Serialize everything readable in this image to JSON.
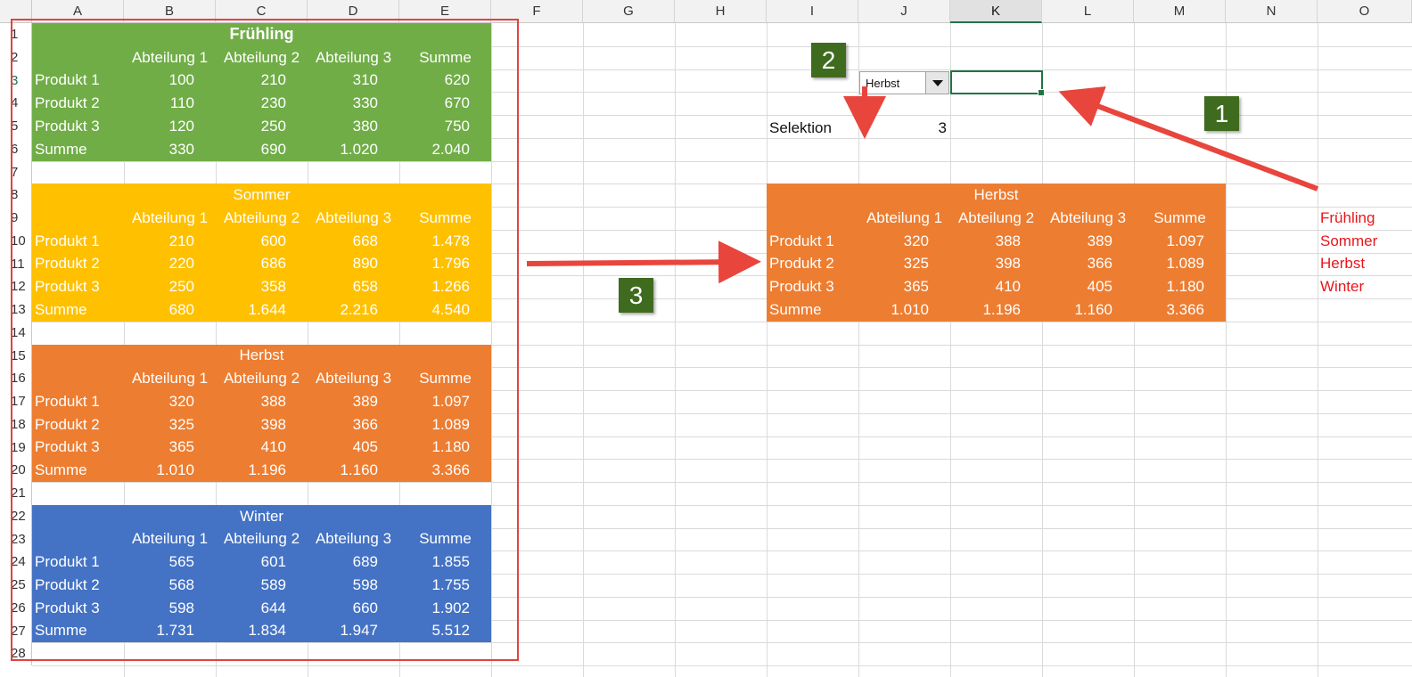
{
  "colors": {
    "spring": "#70ad47",
    "summer": "#ffc000",
    "autumn": "#ed7d31",
    "winter": "#4472c4",
    "arrow": "#e8453c",
    "badge": "#3f6b1f",
    "list_text": "#e8161b"
  },
  "columns": [
    "A",
    "B",
    "C",
    "D",
    "E",
    "F",
    "G",
    "H",
    "I",
    "J",
    "K",
    "L",
    "M",
    "N",
    "O"
  ],
  "selected_column": "K",
  "rows": [
    "1",
    "2",
    "3",
    "4",
    "5",
    "6",
    "7",
    "8",
    "9",
    "10",
    "11",
    "12",
    "13",
    "14",
    "15",
    "16",
    "17",
    "18",
    "19",
    "20",
    "21",
    "22",
    "23",
    "24",
    "25",
    "26",
    "27",
    "28"
  ],
  "selected_row": "3",
  "tables": [
    {
      "title": "Frühling",
      "headers": [
        "Abteilung 1",
        "Abteilung 2",
        "Abteilung 3",
        "Summe"
      ],
      "rows": [
        {
          "label": "Produkt 1",
          "values": [
            "100",
            "210",
            "310",
            "620"
          ]
        },
        {
          "label": "Produkt 2",
          "values": [
            "110",
            "230",
            "330",
            "670"
          ]
        },
        {
          "label": "Produkt 3",
          "values": [
            "120",
            "250",
            "380",
            "750"
          ]
        },
        {
          "label": "Summe",
          "values": [
            "330",
            "690",
            "1.020",
            "2.040"
          ]
        }
      ]
    },
    {
      "title": "Sommer",
      "headers": [
        "Abteilung 1",
        "Abteilung 2",
        "Abteilung 3",
        "Summe"
      ],
      "rows": [
        {
          "label": "Produkt 1",
          "values": [
            "210",
            "600",
            "668",
            "1.478"
          ]
        },
        {
          "label": "Produkt 2",
          "values": [
            "220",
            "686",
            "890",
            "1.796"
          ]
        },
        {
          "label": "Produkt 3",
          "values": [
            "250",
            "358",
            "658",
            "1.266"
          ]
        },
        {
          "label": "Summe",
          "values": [
            "680",
            "1.644",
            "2.216",
            "4.540"
          ]
        }
      ]
    },
    {
      "title": "Herbst",
      "headers": [
        "Abteilung 1",
        "Abteilung 2",
        "Abteilung 3",
        "Summe"
      ],
      "rows": [
        {
          "label": "Produkt 1",
          "values": [
            "320",
            "388",
            "389",
            "1.097"
          ]
        },
        {
          "label": "Produkt 2",
          "values": [
            "325",
            "398",
            "366",
            "1.089"
          ]
        },
        {
          "label": "Produkt 3",
          "values": [
            "365",
            "410",
            "405",
            "1.180"
          ]
        },
        {
          "label": "Summe",
          "values": [
            "1.010",
            "1.196",
            "1.160",
            "3.366"
          ]
        }
      ]
    },
    {
      "title": "Winter",
      "headers": [
        "Abteilung 1",
        "Abteilung 2",
        "Abteilung 3",
        "Summe"
      ],
      "rows": [
        {
          "label": "Produkt 1",
          "values": [
            "565",
            "601",
            "689",
            "1.855"
          ]
        },
        {
          "label": "Produkt 2",
          "values": [
            "568",
            "589",
            "598",
            "1.755"
          ]
        },
        {
          "label": "Produkt 3",
          "values": [
            "598",
            "644",
            "660",
            "1.902"
          ]
        },
        {
          "label": "Summe",
          "values": [
            "1.731",
            "1.834",
            "1.947",
            "5.512"
          ]
        }
      ]
    }
  ],
  "dropdown": {
    "value": "Herbst"
  },
  "selection": {
    "label": "Selektion",
    "value": "3"
  },
  "result_table": {
    "title": "Herbst",
    "headers": [
      "Abteilung 1",
      "Abteilung 2",
      "Abteilung 3",
      "Summe"
    ],
    "rows": [
      {
        "label": "Produkt 1",
        "values": [
          "320",
          "388",
          "389",
          "1.097"
        ]
      },
      {
        "label": "Produkt 2",
        "values": [
          "325",
          "398",
          "366",
          "1.089"
        ]
      },
      {
        "label": "Produkt 3",
        "values": [
          "365",
          "410",
          "405",
          "1.180"
        ]
      },
      {
        "label": "Summe",
        "values": [
          "1.010",
          "1.196",
          "1.160",
          "3.366"
        ]
      }
    ]
  },
  "season_list": [
    "Frühling",
    "Sommer",
    "Herbst",
    "Winter"
  ],
  "badges": {
    "one": "1",
    "two": "2",
    "three": "3"
  }
}
